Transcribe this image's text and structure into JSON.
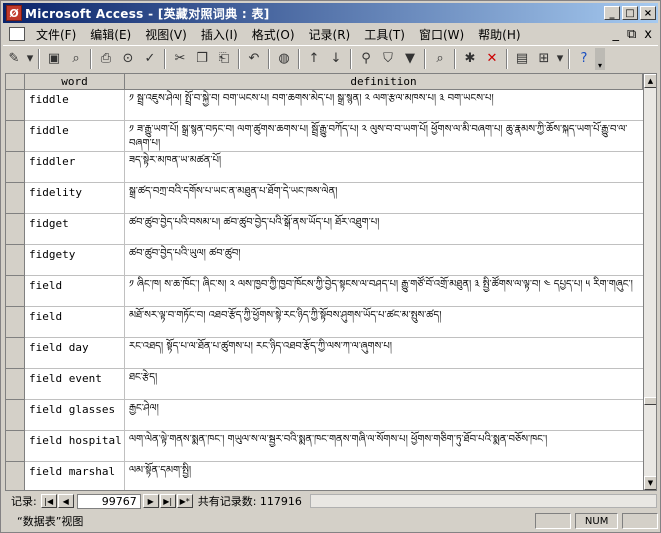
{
  "window": {
    "title": "Microsoft Access - [英藏对照词典 : 表]"
  },
  "menu": {
    "items": [
      "文件(F)",
      "编辑(E)",
      "视图(V)",
      "插入(I)",
      "格式(O)",
      "记录(R)",
      "工具(T)",
      "窗口(W)",
      "帮助(H)"
    ],
    "minimize": "_",
    "restore": "⧉",
    "close": "x"
  },
  "grid": {
    "columns": [
      "word",
      "definition"
    ],
    "rows": [
      {
        "word": "fiddle",
        "def": "༡ སྦྲ་འཇུས་ཤེལ། སྤྲོ་བ་སྐྱེ་བ། བག་ཡངས་པ། བག་ཆགས་མེད་པ། སྒྲ་སྙན། ༢ ལག་རྩལ་མཁས་པ། ༣ བག་ཡངས་པ།"
      },
      {
        "word": "fiddle",
        "def": "༡ ཟ་རྒྱུ་ཡག་པོ། སྒྲ་སྙན་བཏང་བ། ལག་ཚུགས་ཆགས་པ། སྦྲོ་རྒྱུ་བཀོད་པ། ༢ ལུས་བ་བ་ཡག་པོ། ཕྱོགས་ལ་མི་བཞག་པ། ཆུ་རྣམས་ཀྱི་ཆོས་སྐད་ཡག་པོ་རྒྱུ་བ་ལ་བཞག་པ།"
      },
      {
        "word": "fiddler",
        "def": "ཟད་སྟེར་མཁན་ཡ་མཚན་པོ།"
      },
      {
        "word": "fidelity",
        "def": "སྒྲ་ཚད་བཀྲ་བའི་དགོས་པ་ཡང་ན་མཐུན་པ་ཐོག་དེ་ཡང་ཁས་ལེན།"
      },
      {
        "word": "fidget",
        "def": "ཚབ་ཚུབ་བྱེད་པའི་བསམ་པ། ཚབ་ཚུབ་བྱེད་པའི་སྒོ་ནས་ཡོད་པ། ཐོར་འཐུག་པ།"
      },
      {
        "word": "fidgety",
        "def": "ཚབ་ཚུབ་བྱེད་པའི་ཡུལ། ཚབ་ཚུབ།"
      },
      {
        "word": "field",
        "def": "༡ ཞིང་ཁ། ས་ཆ་ཁོང་། ཞིང་ས། ༢ ལས་ཁྱབ་ཀྱི་ཁྱབ་ཁོངས་ཀྱི་བྱེད་སྟངས་ལ་བཤད་པ། རྒྱུ་གཙོ་བོ་འགྲོ་མཐུན། ༣ སྤྱི་ཚོགས་ལ་ལྟ་བ། ༤ དཔྱད་པ། ༥ རིག་གཞུང་།"
      },
      {
        "word": "field",
        "def": "མཐོ་སར་ལྟ་བ་གཏོང་བ། འཐབ་རྩོད་ཀྱི་ཕྱོགས་སྟེ་རང་ཉིད་ཀྱི་སྟོབས་ཤུགས་ཡོད་པ་ཚང་མ་སྤུས་ཚད།"
      },
      {
        "word": "field day",
        "def": "རང་འཐད། སྟོད་པ་ལ་ཐོན་པ་ཚུགས་པ། རང་ཉིད་འཐབ་རྩོད་ཀྱི་ལས་ཀ་ལ་ཞུགས་པ།"
      },
      {
        "word": "field event",
        "def": "ཐང་རྩེད།"
      },
      {
        "word": "field glasses",
        "def": "རྒྱང་ཤེལ།"
      },
      {
        "word": "field hospital",
        "def": "ལག་ལེན་ལྟེ་གནས་སྨན་ཁང་། གཡུལ་ས་ལ་སྦྱར་བའི་སྨན་ཁང་གནས་གཞི་ལ་སོགས་པ། ཕྱོགས་གཅིག་ཏུ་ཐོབ་པའི་སྨན་བཅོས་ཁང་།"
      },
      {
        "word": "field marshal",
        "def": "ལམ་སྟོན་དམག་སྤྱི།"
      }
    ]
  },
  "recordNav": {
    "label": "记录:",
    "current": "99767",
    "totalLabel": "共有记录数: 117916"
  },
  "status": {
    "text": "“数据表”视图",
    "num": "NUM"
  }
}
